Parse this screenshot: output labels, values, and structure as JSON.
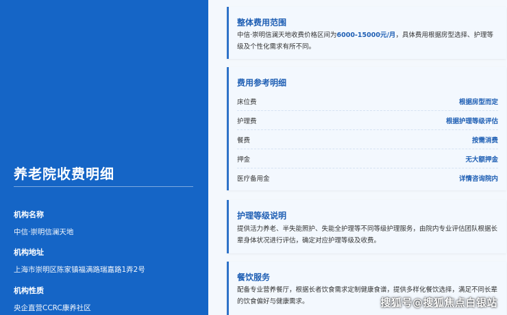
{
  "sidebar": {
    "title": "养老院收费明细",
    "fields": [
      {
        "label": "机构名称",
        "value": "中信·崇明信澜天地"
      },
      {
        "label": "机构地址",
        "value": "上海市崇明区陈家镇福满路瑞嘉路1弄2号"
      },
      {
        "label": "机构性质",
        "value": "央企直营CCRC康养社区"
      }
    ]
  },
  "overall": {
    "title": "整体费用范围",
    "text_before": "中信·崇明信澜天地收费价格区间为",
    "highlight": "6000-15000元/月",
    "text_after": "，具体费用根据房型选择、护理等级及个性化需求有所不同。"
  },
  "details": {
    "title": "费用参考明细",
    "rows": [
      {
        "label": "床位费",
        "value": "根据房型而定"
      },
      {
        "label": "护理费",
        "value": "根据护理等级评估"
      },
      {
        "label": "餐费",
        "value": "按需消费"
      },
      {
        "label": "押金",
        "value": "无大额押金"
      },
      {
        "label": "医疗备用金",
        "value": "详情咨询院内"
      }
    ]
  },
  "care": {
    "title": "护理等级说明",
    "text": "提供活力养老、半失能照护、失能全护理等不同等级护理服务，由院内专业评估团队根据长辈身体状况进行评估，确定对应护理等级及收费。"
  },
  "dining": {
    "title": "餐饮服务",
    "text": "配备专业营养餐厅，根据长者饮食需求定制健康食谱，提供多样化餐饮选择，满足不同长辈的饮食偏好与健康需求。"
  },
  "watermark": "搜狐号@搜狐焦点白银站",
  "colors": {
    "sidebar_bg": "#1565c6",
    "accent": "#1f5fb4",
    "card_bg": "#f3f8fe"
  }
}
